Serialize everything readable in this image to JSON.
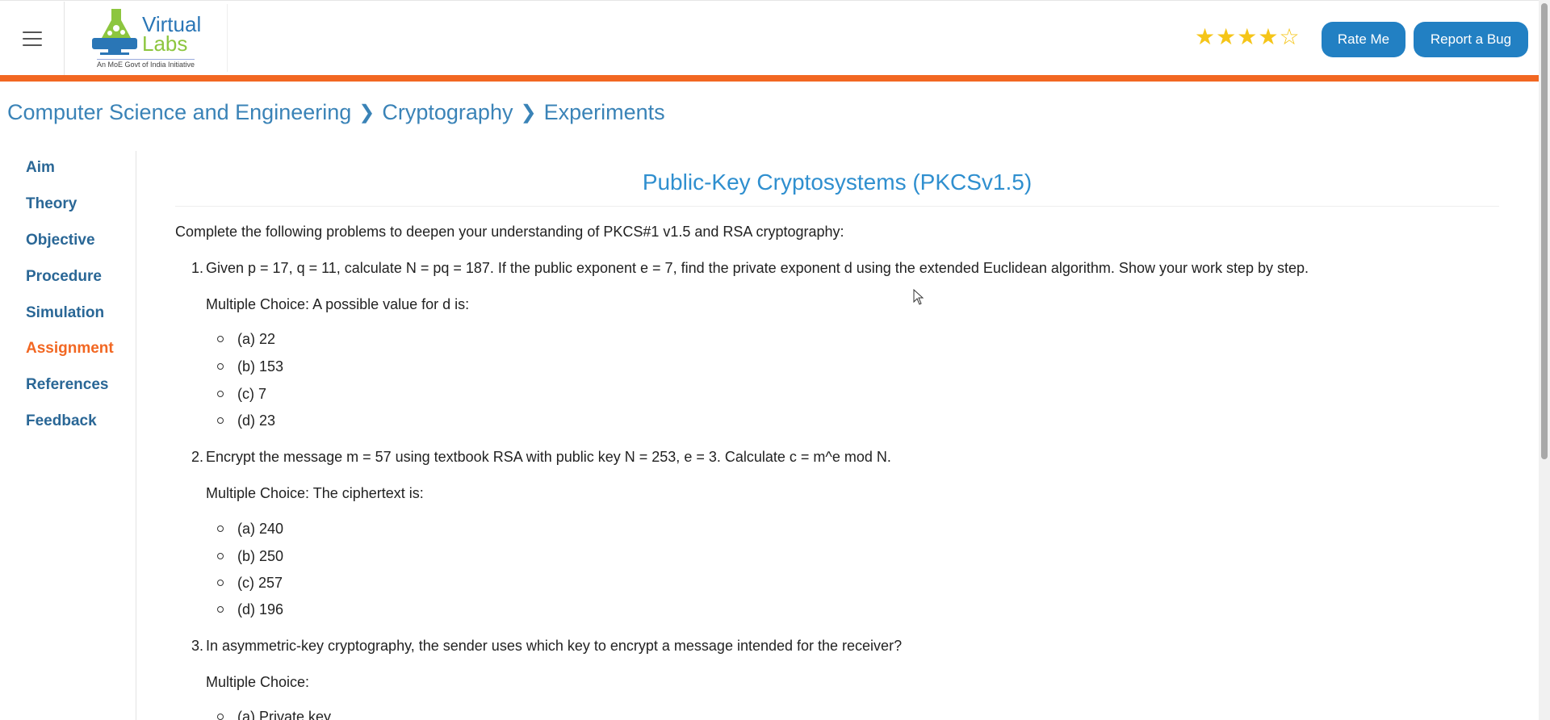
{
  "header": {
    "logo": {
      "word1": "Virtual",
      "word2": "Labs",
      "tagline": "An MoE Govt of India Initiative"
    },
    "rating": {
      "value": 4,
      "max": 5,
      "star_color": "#f5c518"
    },
    "rate_label": "Rate Me",
    "bug_label": "Report a Bug",
    "accent_color": "#f26722"
  },
  "breadcrumb": [
    "Computer Science and Engineering",
    "Cryptography",
    "Experiments"
  ],
  "sidebar": {
    "items": [
      {
        "label": "Aim"
      },
      {
        "label": "Theory"
      },
      {
        "label": "Objective"
      },
      {
        "label": "Procedure"
      },
      {
        "label": "Simulation"
      },
      {
        "label": "Assignment",
        "active": true
      },
      {
        "label": "References"
      },
      {
        "label": "Feedback"
      }
    ]
  },
  "main": {
    "title": "Public-Key Cryptosystems (PKCSv1.5)",
    "intro": "Complete the following problems to deepen your understanding of PKCS#1 v1.5 and RSA cryptography:",
    "questions": [
      {
        "num": "1.",
        "text": "Given p = 17, q = 11, calculate N = pq = 187. If the public exponent e = 7, find the private exponent d using the extended Euclidean algorithm. Show your work step by step.",
        "mc": "Multiple Choice: A possible value for d is:",
        "options": [
          "(a) 22",
          "(b) 153",
          "(c) 7",
          "(d) 23"
        ]
      },
      {
        "num": "2.",
        "text": "Encrypt the message m = 57 using textbook RSA with public key N = 253, e = 3. Calculate c = m^e mod N.",
        "mc": "Multiple Choice: The ciphertext is:",
        "options": [
          "(a) 240",
          "(b) 250",
          "(c) 257",
          "(d) 196"
        ]
      },
      {
        "num": "3.",
        "text": "In asymmetric-key cryptography, the sender uses which key to encrypt a message intended for the receiver?",
        "mc": "Multiple Choice:",
        "options": [
          "(a) Private key"
        ]
      }
    ]
  }
}
